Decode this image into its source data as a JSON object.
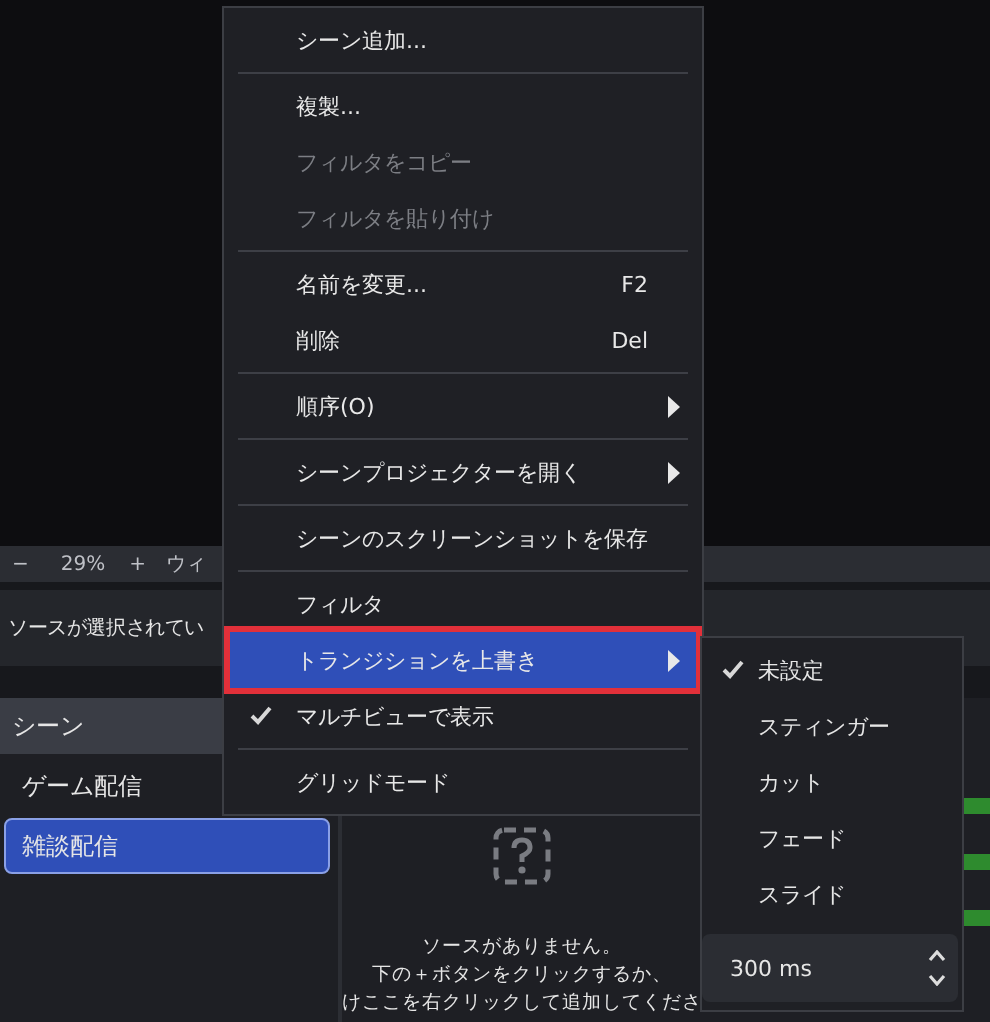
{
  "preview_bar": {
    "minus": "−",
    "zoom": "29%",
    "plus": "+",
    "cut_label": "ウィ"
  },
  "source_bar": {
    "text": "ソースが選択されてい"
  },
  "scenes": {
    "title": "シーン",
    "items": [
      {
        "label": "ゲーム配信",
        "selected": false
      },
      {
        "label": "雑談配信",
        "selected": true
      }
    ]
  },
  "sources": {
    "empty_lines": [
      "ソースがありません。",
      "下の＋ボタンをクリックするか、",
      "けここを右クリックして追加してくださ"
    ]
  },
  "context_menu": {
    "items": [
      {
        "kind": "item",
        "label": "シーン追加...",
        "disabled": false,
        "submenu": false,
        "checked": false,
        "selected": false
      },
      {
        "kind": "separator"
      },
      {
        "kind": "item",
        "label": "複製...",
        "disabled": false,
        "submenu": false,
        "checked": false,
        "selected": false
      },
      {
        "kind": "item",
        "label": "フィルタをコピー",
        "disabled": true,
        "submenu": false,
        "checked": false,
        "selected": false
      },
      {
        "kind": "item",
        "label": "フィルタを貼り付け",
        "disabled": true,
        "submenu": false,
        "checked": false,
        "selected": false
      },
      {
        "kind": "separator"
      },
      {
        "kind": "item",
        "label": "名前を変更...",
        "shortcut": "F2",
        "disabled": false,
        "submenu": false,
        "checked": false,
        "selected": false
      },
      {
        "kind": "item",
        "label": "削除",
        "shortcut": "Del",
        "disabled": false,
        "submenu": false,
        "checked": false,
        "selected": false
      },
      {
        "kind": "separator"
      },
      {
        "kind": "item",
        "label": "順序(O)",
        "disabled": false,
        "submenu": true,
        "checked": false,
        "selected": false
      },
      {
        "kind": "separator"
      },
      {
        "kind": "item",
        "label": "シーンプロジェクターを開く",
        "disabled": false,
        "submenu": true,
        "checked": false,
        "selected": false
      },
      {
        "kind": "separator"
      },
      {
        "kind": "item",
        "label": "シーンのスクリーンショットを保存",
        "disabled": false,
        "submenu": false,
        "checked": false,
        "selected": false
      },
      {
        "kind": "separator"
      },
      {
        "kind": "item",
        "label": "フィルタ",
        "disabled": false,
        "submenu": false,
        "checked": false,
        "selected": false
      },
      {
        "kind": "item",
        "label": "トランジションを上書き",
        "disabled": false,
        "submenu": true,
        "checked": false,
        "selected": true
      },
      {
        "kind": "item",
        "label": "マルチビューで表示",
        "disabled": false,
        "submenu": false,
        "checked": true,
        "selected": false
      },
      {
        "kind": "separator"
      },
      {
        "kind": "item",
        "label": "グリッドモード",
        "disabled": false,
        "submenu": false,
        "checked": false,
        "selected": false
      }
    ]
  },
  "submenu": {
    "items": [
      {
        "label": "未設定",
        "checked": true
      },
      {
        "label": "スティンガー",
        "checked": false
      },
      {
        "label": "カット",
        "checked": false
      },
      {
        "label": "フェード",
        "checked": false
      },
      {
        "label": "スライド",
        "checked": false
      }
    ],
    "duration": "300 ms"
  }
}
